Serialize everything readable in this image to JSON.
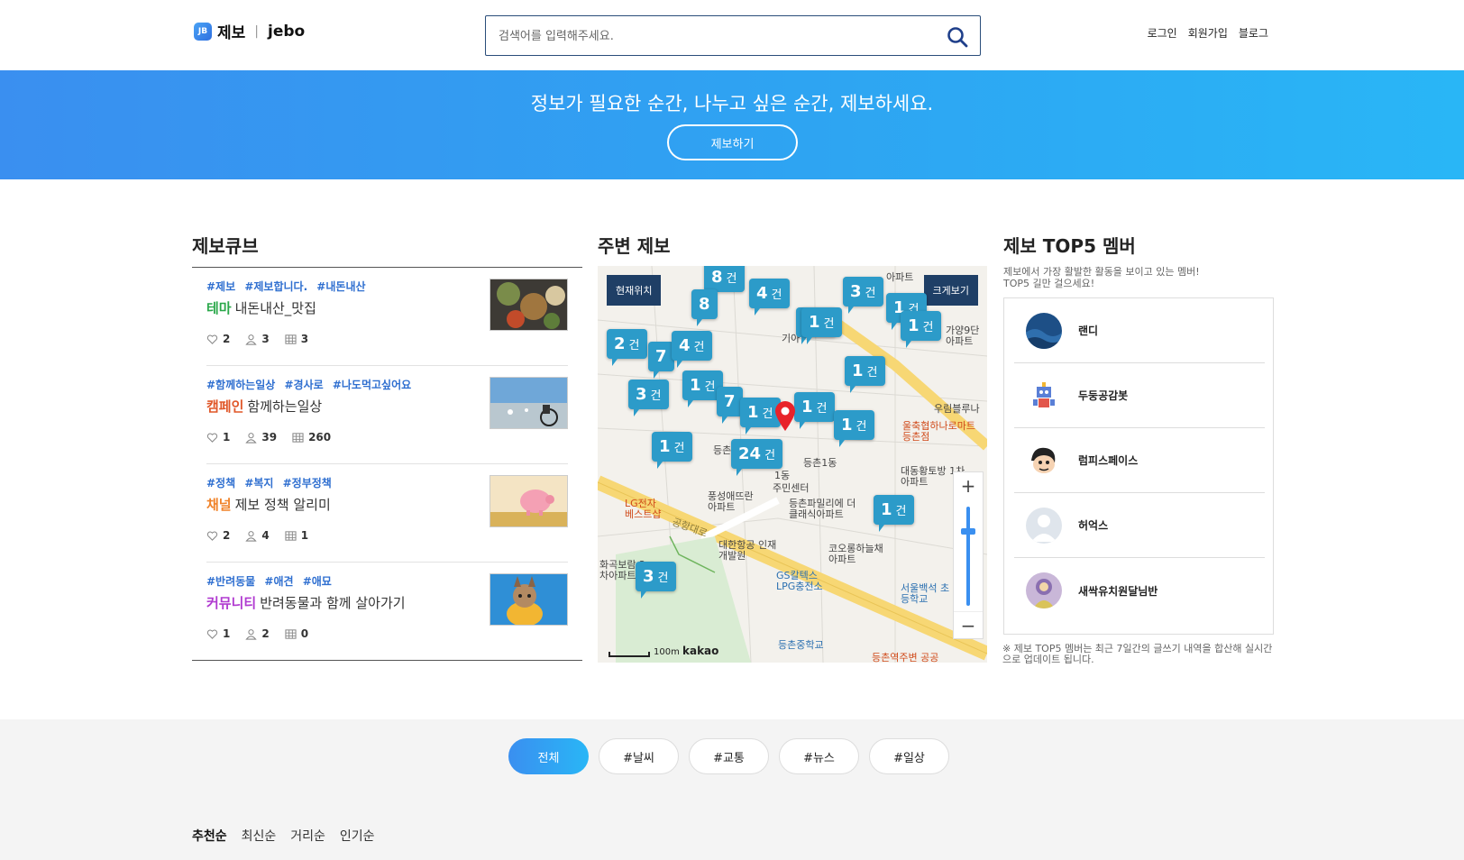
{
  "header": {
    "logo_mark": "JB",
    "logo_text": "제보",
    "logo_sep": "|",
    "logo_en": "jebo",
    "search_placeholder": "검색어를 입력해주세요.",
    "auth": [
      "로그인",
      "회원가입",
      "블로그"
    ]
  },
  "hero": {
    "slogan": "정보가 필요한 순간, 나누고 싶은 순간, 제보하세요.",
    "button": "제보하기"
  },
  "sections": {
    "cube": "제보큐브",
    "map": "주변 제보",
    "top5": "제보 TOP5 멤버"
  },
  "cubes": [
    {
      "tags": "#제보 #제보합니다. #내돈내산",
      "category": "테마",
      "category_color": "#2aa84a",
      "title": "내돈내산_맛집",
      "likes": "2",
      "members": "3",
      "posts": "3"
    },
    {
      "tags": "#함께하는일상 #경사로 #나도먹고싶어요",
      "category": "캠페인",
      "category_color": "#e0582a",
      "title": "함께하는일상",
      "likes": "1",
      "members": "39",
      "posts": "260"
    },
    {
      "tags": "#정책 #복지 #정부정책",
      "category": "채널",
      "category_color": "#f0832a",
      "title": "제보 정책 알리미",
      "likes": "2",
      "members": "4",
      "posts": "1"
    },
    {
      "tags": "#반려동물 #애견 #애묘",
      "category": "커뮤니티",
      "category_color": "#b03ad0",
      "title": "반려동물과 함께 살아가기",
      "likes": "1",
      "members": "2",
      "posts": "0"
    }
  ],
  "map": {
    "current_location": "현재위치",
    "enlarge": "크게보기",
    "unit": "건",
    "pins": [
      "8",
      "4",
      "3",
      "1",
      "1",
      "1",
      "2",
      "7",
      "4",
      "1",
      "3",
      "1",
      "7",
      "1",
      "1",
      "1",
      "1",
      "24",
      "1",
      "1",
      "3",
      "8"
    ],
    "labels": [
      "기아",
      "아파트",
      "가양9단 아파트",
      "우림블루나",
      "울축협하나로마트 등촌점",
      "대동황토방 1차아파트",
      "등촌동",
      "풍성애뜨란 아파트",
      "등촌파밀리에 더클래식아파트",
      "LG전자 베스트샵",
      "공항대로",
      "대한항공 인재개발원",
      "코오롱하늘채 아파트",
      "화곡보람 2차아파트",
      "GS칼텍스 LPG충전소",
      "서울백석 초등학교",
      "등촌중학교",
      "등촌역주변 공공",
      "주민센터",
      "1동",
      "등촌1동"
    ],
    "scale": "100m",
    "brand": "kakao"
  },
  "top5": {
    "desc_line1": "제보에서 가장 활발한 활동을 보이고 있는 멤버!",
    "desc_line2": "TOP5 길만 걸으세요!",
    "members": [
      "랜디",
      "두둥공감봇",
      "럼피스페이스",
      "허억스",
      "새싹유치원달님반"
    ],
    "note": "※ 제보 TOP5 멤버는 최근 7일간의 글쓰기 내역을 합산해 실시간으로 업데이트 됩니다."
  },
  "filters": [
    "전체",
    "#날씨",
    "#교통",
    "#뉴스",
    "#일상"
  ],
  "sort": [
    "추천순",
    "최신순",
    "거리순",
    "인기순"
  ],
  "colors": {
    "accent": "#3a8ff0",
    "hero_end": "#29b6f6",
    "pin": "#2c9bc9",
    "nav_dark": "#1f3f66"
  }
}
